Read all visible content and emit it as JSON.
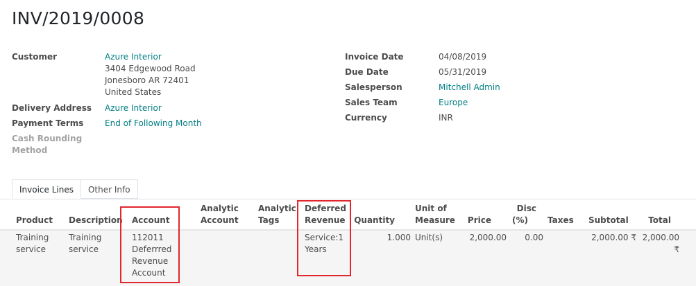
{
  "title": "INV/2019/0008",
  "left_fields": {
    "customer_label": "Customer",
    "customer_name": "Azure Interior",
    "address_line1": "3404 Edgewood Road",
    "address_line2": "Jonesboro AR 72401",
    "address_line3": "United States",
    "delivery_label": "Delivery Address",
    "delivery_value": "Azure Interior",
    "payment_terms_label": "Payment Terms",
    "payment_terms_value": "End of Following Month",
    "cash_rounding_label_1": "Cash Rounding",
    "cash_rounding_label_2": "Method"
  },
  "right_fields": {
    "invoice_date_label": "Invoice Date",
    "invoice_date_value": "04/08/2019",
    "due_date_label": "Due Date",
    "due_date_value": "05/31/2019",
    "salesperson_label": "Salesperson",
    "salesperson_value": "Mitchell Admin",
    "sales_team_label": "Sales Team",
    "sales_team_value": "Europe",
    "currency_label": "Currency",
    "currency_value": "INR"
  },
  "tabs": [
    {
      "label": "Invoice Lines"
    },
    {
      "label": "Other Info"
    }
  ],
  "table": {
    "headers": {
      "product": "Product",
      "description": "Description",
      "account": "Account",
      "analytic_account_1": "Analytic",
      "analytic_account_2": "Account",
      "analytic_tags_1": "Analytic",
      "analytic_tags_2": "Tags",
      "deferred_revenue_1": "Deferred",
      "deferred_revenue_2": "Revenue",
      "quantity": "Quantity",
      "uom_1": "Unit of",
      "uom_2": "Measure",
      "price": "Price",
      "disc_1": "Disc",
      "disc_2": "(%)",
      "taxes": "Taxes",
      "subtotal": "Subtotal",
      "total": "Total"
    },
    "row": {
      "product_1": "Training",
      "product_2": "service",
      "description_1": "Training",
      "description_2": "service",
      "account_1": "112011",
      "account_2": "Deferrred",
      "account_3": "Revenue",
      "account_4": "Account",
      "deferred_1": "Service:1",
      "deferred_2": "Years",
      "quantity": "1.000",
      "uom": "Unit(s)",
      "price": "2,000.00",
      "disc": "0.00",
      "subtotal": "2,000.00 ₹",
      "total": "2,000.00 ₹"
    }
  },
  "colors": {
    "link": "#017e84",
    "highlight": "#e3262d"
  }
}
